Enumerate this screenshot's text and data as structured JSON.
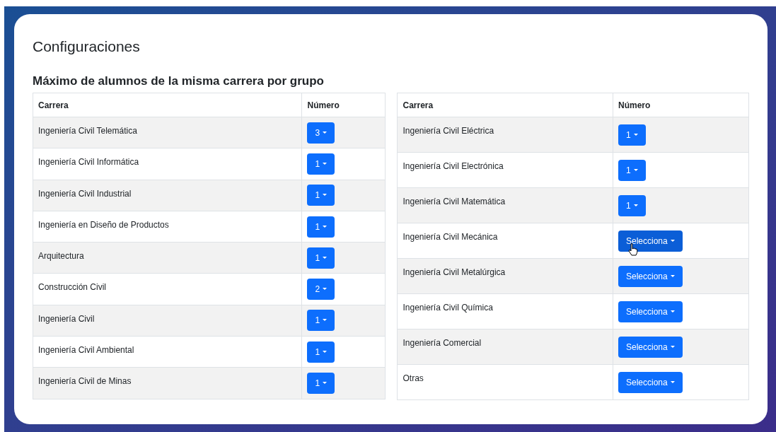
{
  "title": "Configuraciones",
  "section_title": "Máximo de alumnos de la misma carrera por grupo",
  "tables": [
    {
      "columns": [
        "Carrera",
        "Número"
      ],
      "rows": [
        {
          "carrera": "Ingeniería Civil Telemática",
          "numero": "3",
          "hovered": false
        },
        {
          "carrera": "Ingeniería Civil Informática",
          "numero": "1",
          "hovered": false
        },
        {
          "carrera": "Ingeniería Civil Industrial",
          "numero": "1",
          "hovered": false
        },
        {
          "carrera": "Ingeniería en Diseño de Productos",
          "numero": "1",
          "hovered": false
        },
        {
          "carrera": "Arquitectura",
          "numero": "1",
          "hovered": false
        },
        {
          "carrera": "Construcción Civil",
          "numero": "2",
          "hovered": false
        },
        {
          "carrera": "Ingeniería Civil",
          "numero": "1",
          "hovered": false
        },
        {
          "carrera": "Ingeniería Civil Ambiental",
          "numero": "1",
          "hovered": false
        },
        {
          "carrera": "Ingeniería Civil de Minas",
          "numero": "1",
          "hovered": false
        }
      ]
    },
    {
      "columns": [
        "Carrera",
        "Número"
      ],
      "rows": [
        {
          "carrera": "Ingeniería Civil Eléctrica",
          "numero": "1",
          "hovered": false
        },
        {
          "carrera": "Ingeniería Civil Electrónica",
          "numero": "1",
          "hovered": false
        },
        {
          "carrera": "Ingeniería Civil Matemática",
          "numero": "1",
          "hovered": false
        },
        {
          "carrera": "Ingeniería Civil Mecánica",
          "numero": "Selecciona",
          "hovered": true
        },
        {
          "carrera": "Ingeniería Civil Metalúrgica",
          "numero": "Selecciona",
          "hovered": false
        },
        {
          "carrera": "Ingeniería Civil Química",
          "numero": "Selecciona",
          "hovered": false
        },
        {
          "carrera": "Ingeniería Comercial",
          "numero": "Selecciona",
          "hovered": false
        },
        {
          "carrera": "Otras",
          "numero": "Selecciona",
          "hovered": false
        }
      ]
    }
  ]
}
